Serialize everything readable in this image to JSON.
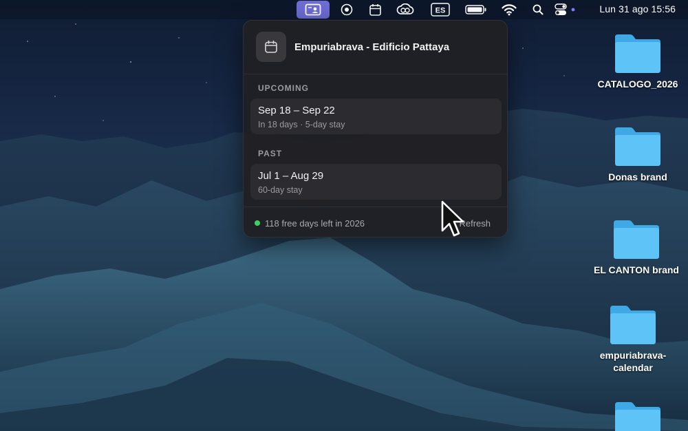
{
  "menubar": {
    "icons": [
      "profile-card-icon",
      "record-icon",
      "calendar-icon",
      "creative-cloud-icon",
      "input-source-icon",
      "battery-icon",
      "wifi-icon",
      "search-icon",
      "control-center-icon"
    ],
    "input_source": "ES",
    "clock": "Lun 31 ago 15:56",
    "active_color": "#6d6dd6"
  },
  "popover": {
    "title": "Empuriabrava - Edificio Pattaya",
    "upcoming": {
      "label": "UPCOMING",
      "stays": [
        {
          "dates": "Sep 18 – Sep 22",
          "detail": "In 18 days · 5-day stay"
        }
      ]
    },
    "past": {
      "label": "PAST",
      "stays": [
        {
          "dates": "Jul 1 – Aug 29",
          "detail": "60-day stay"
        }
      ]
    },
    "footer": {
      "free_days": "118 free days left in 2026",
      "refresh": "Refresh",
      "status_color": "#3ecf5c"
    }
  },
  "desktop": {
    "items": [
      {
        "label": "CATALOGO_2026"
      },
      {
        "label": "Donas brand"
      },
      {
        "label": "EL CANTON brand"
      },
      {
        "label": "empuriabrava-calendar"
      },
      {
        "label": ""
      }
    ],
    "folder_color": "#5ac0f5"
  }
}
